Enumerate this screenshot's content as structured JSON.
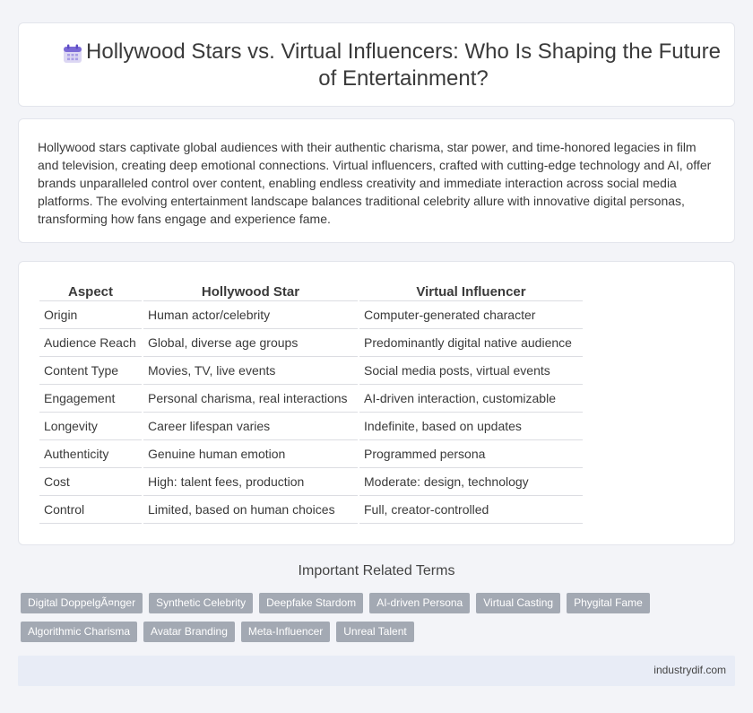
{
  "header": {
    "icon": "calendar-icon",
    "title": "Hollywood Stars vs. Virtual Influencers: Who Is Shaping the Future of Entertainment?"
  },
  "intro": "Hollywood stars captivate global audiences with their authentic charisma, star power, and time-honored legacies in film and television, creating deep emotional connections. Virtual influencers, crafted with cutting-edge technology and AI, offer brands unparalleled control over content, enabling endless creativity and immediate interaction across social media platforms. The evolving entertainment landscape balances traditional celebrity allure with innovative digital personas, transforming how fans engage and experience fame.",
  "comparison": {
    "headers": [
      "Aspect",
      "Hollywood Star",
      "Virtual Influencer"
    ],
    "rows": [
      [
        "Origin",
        "Human actor/celebrity",
        "Computer-generated character"
      ],
      [
        "Audience Reach",
        "Global, diverse age groups",
        "Predominantly digital native audience"
      ],
      [
        "Content Type",
        "Movies, TV, live events",
        "Social media posts, virtual events"
      ],
      [
        "Engagement",
        "Personal charisma, real interactions",
        "AI-driven interaction, customizable"
      ],
      [
        "Longevity",
        "Career lifespan varies",
        "Indefinite, based on updates"
      ],
      [
        "Authenticity",
        "Genuine human emotion",
        "Programmed persona"
      ],
      [
        "Cost",
        "High: talent fees, production",
        "Moderate: design, technology"
      ],
      [
        "Control",
        "Limited, based on human choices",
        "Full, creator-controlled"
      ]
    ]
  },
  "related": {
    "title": "Important Related Terms",
    "terms": [
      "Digital DoppelgÃ¤nger",
      "Synthetic Celebrity",
      "Deepfake Stardom",
      "AI-driven Persona",
      "Virtual Casting",
      "Phygital Fame",
      "Algorithmic Charisma",
      "Avatar Branding",
      "Meta-Influencer",
      "Unreal Talent"
    ]
  },
  "footer": {
    "site": "industrydif.com"
  }
}
